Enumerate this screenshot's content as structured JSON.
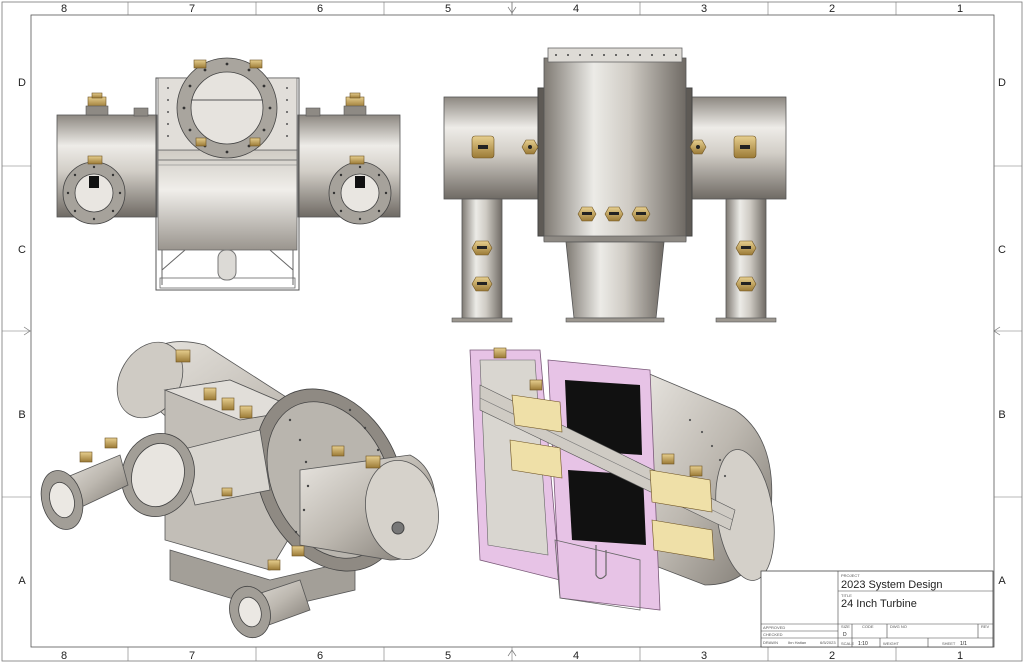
{
  "zones": {
    "columns": [
      "8",
      "7",
      "6",
      "5",
      "4",
      "3",
      "2",
      "1"
    ],
    "rows": [
      "D",
      "C",
      "B",
      "A"
    ]
  },
  "title_block": {
    "project_label": "PROJECT",
    "project": "2023 System Design",
    "title_label": "TITLE",
    "title": "24 Inch Turbine",
    "approved_label": "APPROVED",
    "checked_label": "CHECKED",
    "drawn_label": "DRAWN",
    "drawn_by": "Ibn Haitan",
    "drawn_date": "6/5/2023",
    "size_label": "SIZE",
    "size": "D",
    "code_label": "CODE",
    "dwg_no_label": "DWG NO",
    "rev_label": "REV",
    "scale_label": "SCALE",
    "scale": "1:10",
    "weight_label": "WEIGHT",
    "sheet_label": "SHEET",
    "sheet": "1/1"
  },
  "colors": {
    "frame": "#555555",
    "steel_light": "#e6e4e0",
    "steel_mid": "#b9b5ae",
    "steel_dark": "#6e6a64",
    "brass": "#c9a45a",
    "section_pink": "#e7c3e6",
    "winding_yellow": "#efe0a8",
    "core_black": "#111111"
  }
}
